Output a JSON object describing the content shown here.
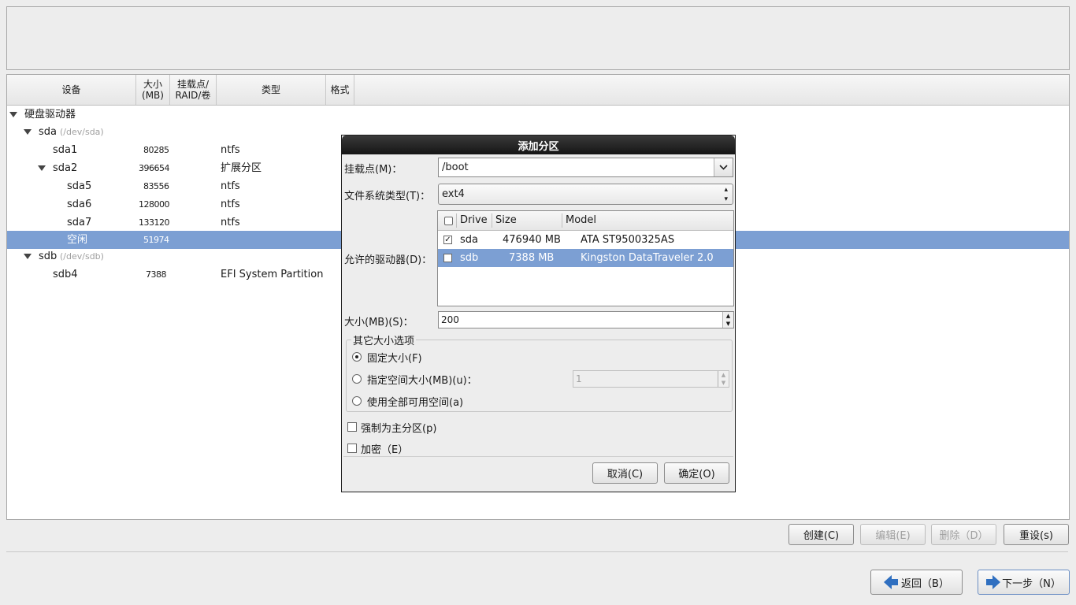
{
  "tree": {
    "columns": {
      "device": "设备",
      "size": "大小\n(MB)",
      "mount": "挂载点/\nRAID/卷",
      "type": "类型",
      "format": "格式"
    },
    "rows": [
      {
        "label": "硬盘驱动器",
        "path": "",
        "size": "",
        "type": ""
      },
      {
        "label": "sda",
        "path": "(/dev/sda)",
        "size": "",
        "type": ""
      },
      {
        "label": "sda1",
        "path": "",
        "size": "80285",
        "type": "ntfs"
      },
      {
        "label": "sda2",
        "path": "",
        "size": "396654",
        "type": "扩展分区"
      },
      {
        "label": "sda5",
        "path": "",
        "size": "83556",
        "type": "ntfs"
      },
      {
        "label": "sda6",
        "path": "",
        "size": "128000",
        "type": "ntfs"
      },
      {
        "label": "sda7",
        "path": "",
        "size": "133120",
        "type": "ntfs"
      },
      {
        "label": "空闲",
        "path": "",
        "size": "51974",
        "type": ""
      },
      {
        "label": "sdb",
        "path": "(/dev/sdb)",
        "size": "",
        "type": ""
      },
      {
        "label": "sdb4",
        "path": "",
        "size": "7388",
        "type": "EFI System Partition"
      }
    ]
  },
  "actions": {
    "create": "创建(C)",
    "edit": "编辑(E)",
    "delete": "删除（D）",
    "reset": "重设(s)"
  },
  "nav": {
    "back": "返回（B）",
    "next": "下一步（N）"
  },
  "dialog": {
    "title": "添加分区",
    "mount_label": "挂载点(M)：",
    "mount_value": "/boot",
    "fstype_label": "文件系统类型(T)：",
    "fstype_value": "ext4",
    "drives_label": "允许的驱动器(D)：",
    "drive_columns": {
      "drive": "Drive",
      "size": "Size",
      "model": "Model"
    },
    "drives": [
      {
        "drive": "sda",
        "size": "476940 MB",
        "model": "ATA ST9500325AS",
        "checked": true
      },
      {
        "drive": "sdb",
        "size": "7388 MB",
        "model": "Kingston DataTraveler 2.0",
        "checked": false
      }
    ],
    "size_label": "大小(MB)(S)：",
    "size_value": "200",
    "group_title": "其它大小选项",
    "opt_fixed": "固定大小(F)",
    "opt_specify": "指定空间大小(MB)(u)：",
    "opt_specify_value": "1",
    "opt_fill": "使用全部可用空间(a)",
    "force_primary": "强制为主分区(p)",
    "encrypt": "加密（E）",
    "cancel": "取消(C)",
    "ok": "确定(O)"
  }
}
